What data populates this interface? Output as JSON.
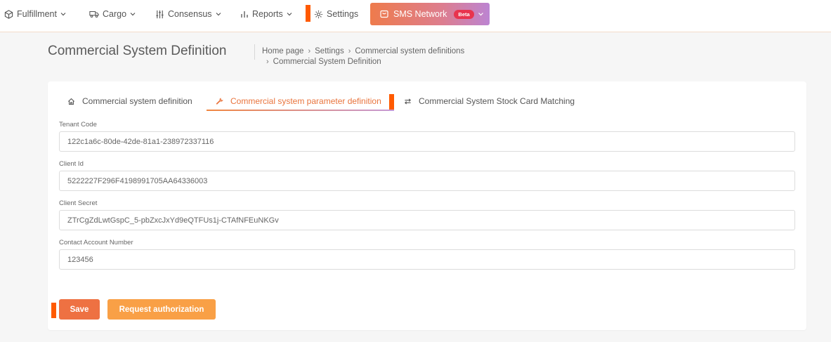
{
  "nav": {
    "items": [
      {
        "label": "Fulfillment",
        "icon": "box-gear-icon"
      },
      {
        "label": "Cargo",
        "icon": "truck-icon"
      },
      {
        "label": "Consensus",
        "icon": "sliders-icon"
      },
      {
        "label": "Reports",
        "icon": "bar-chart-icon"
      },
      {
        "label": "Settings",
        "icon": "gear-icon"
      }
    ],
    "sms": {
      "label": "SMS Network",
      "badge": "Beta",
      "icon": "message-icon"
    }
  },
  "header": {
    "title": "Commercial System Definition",
    "breadcrumb": [
      "Home page",
      "Settings",
      "Commercial system definitions",
      "Commercial System Definition"
    ]
  },
  "tabs": [
    {
      "label": "Commercial system definition",
      "icon": "home-icon",
      "active": false
    },
    {
      "label": "Commercial system parameter definition",
      "icon": "wrench-icon",
      "active": true
    },
    {
      "label": "Commercial System Stock Card Matching",
      "icon": "swap-icon",
      "active": false
    }
  ],
  "form": {
    "tenant_code": {
      "label": "Tenant Code",
      "value": "122c1a6c-80de-42de-81a1-238972337116"
    },
    "client_id": {
      "label": "Client Id",
      "value": "5222227F296F4198991705AA64336003"
    },
    "client_secret": {
      "label": "Client Secret",
      "value": "ZTrCgZdLwtGspC_5-pbZxcJxYd9eQTFUs1j-CTAfNFEuNKGv"
    },
    "contact_account_number": {
      "label": "Contact Account Number",
      "value": "123456"
    }
  },
  "buttons": {
    "save": "Save",
    "request_authorization": "Request authorization"
  },
  "colors": {
    "accent": "#ee7142",
    "accent_secondary": "#f9a046",
    "marker": "#ff5a00",
    "badge": "#e8344e"
  }
}
